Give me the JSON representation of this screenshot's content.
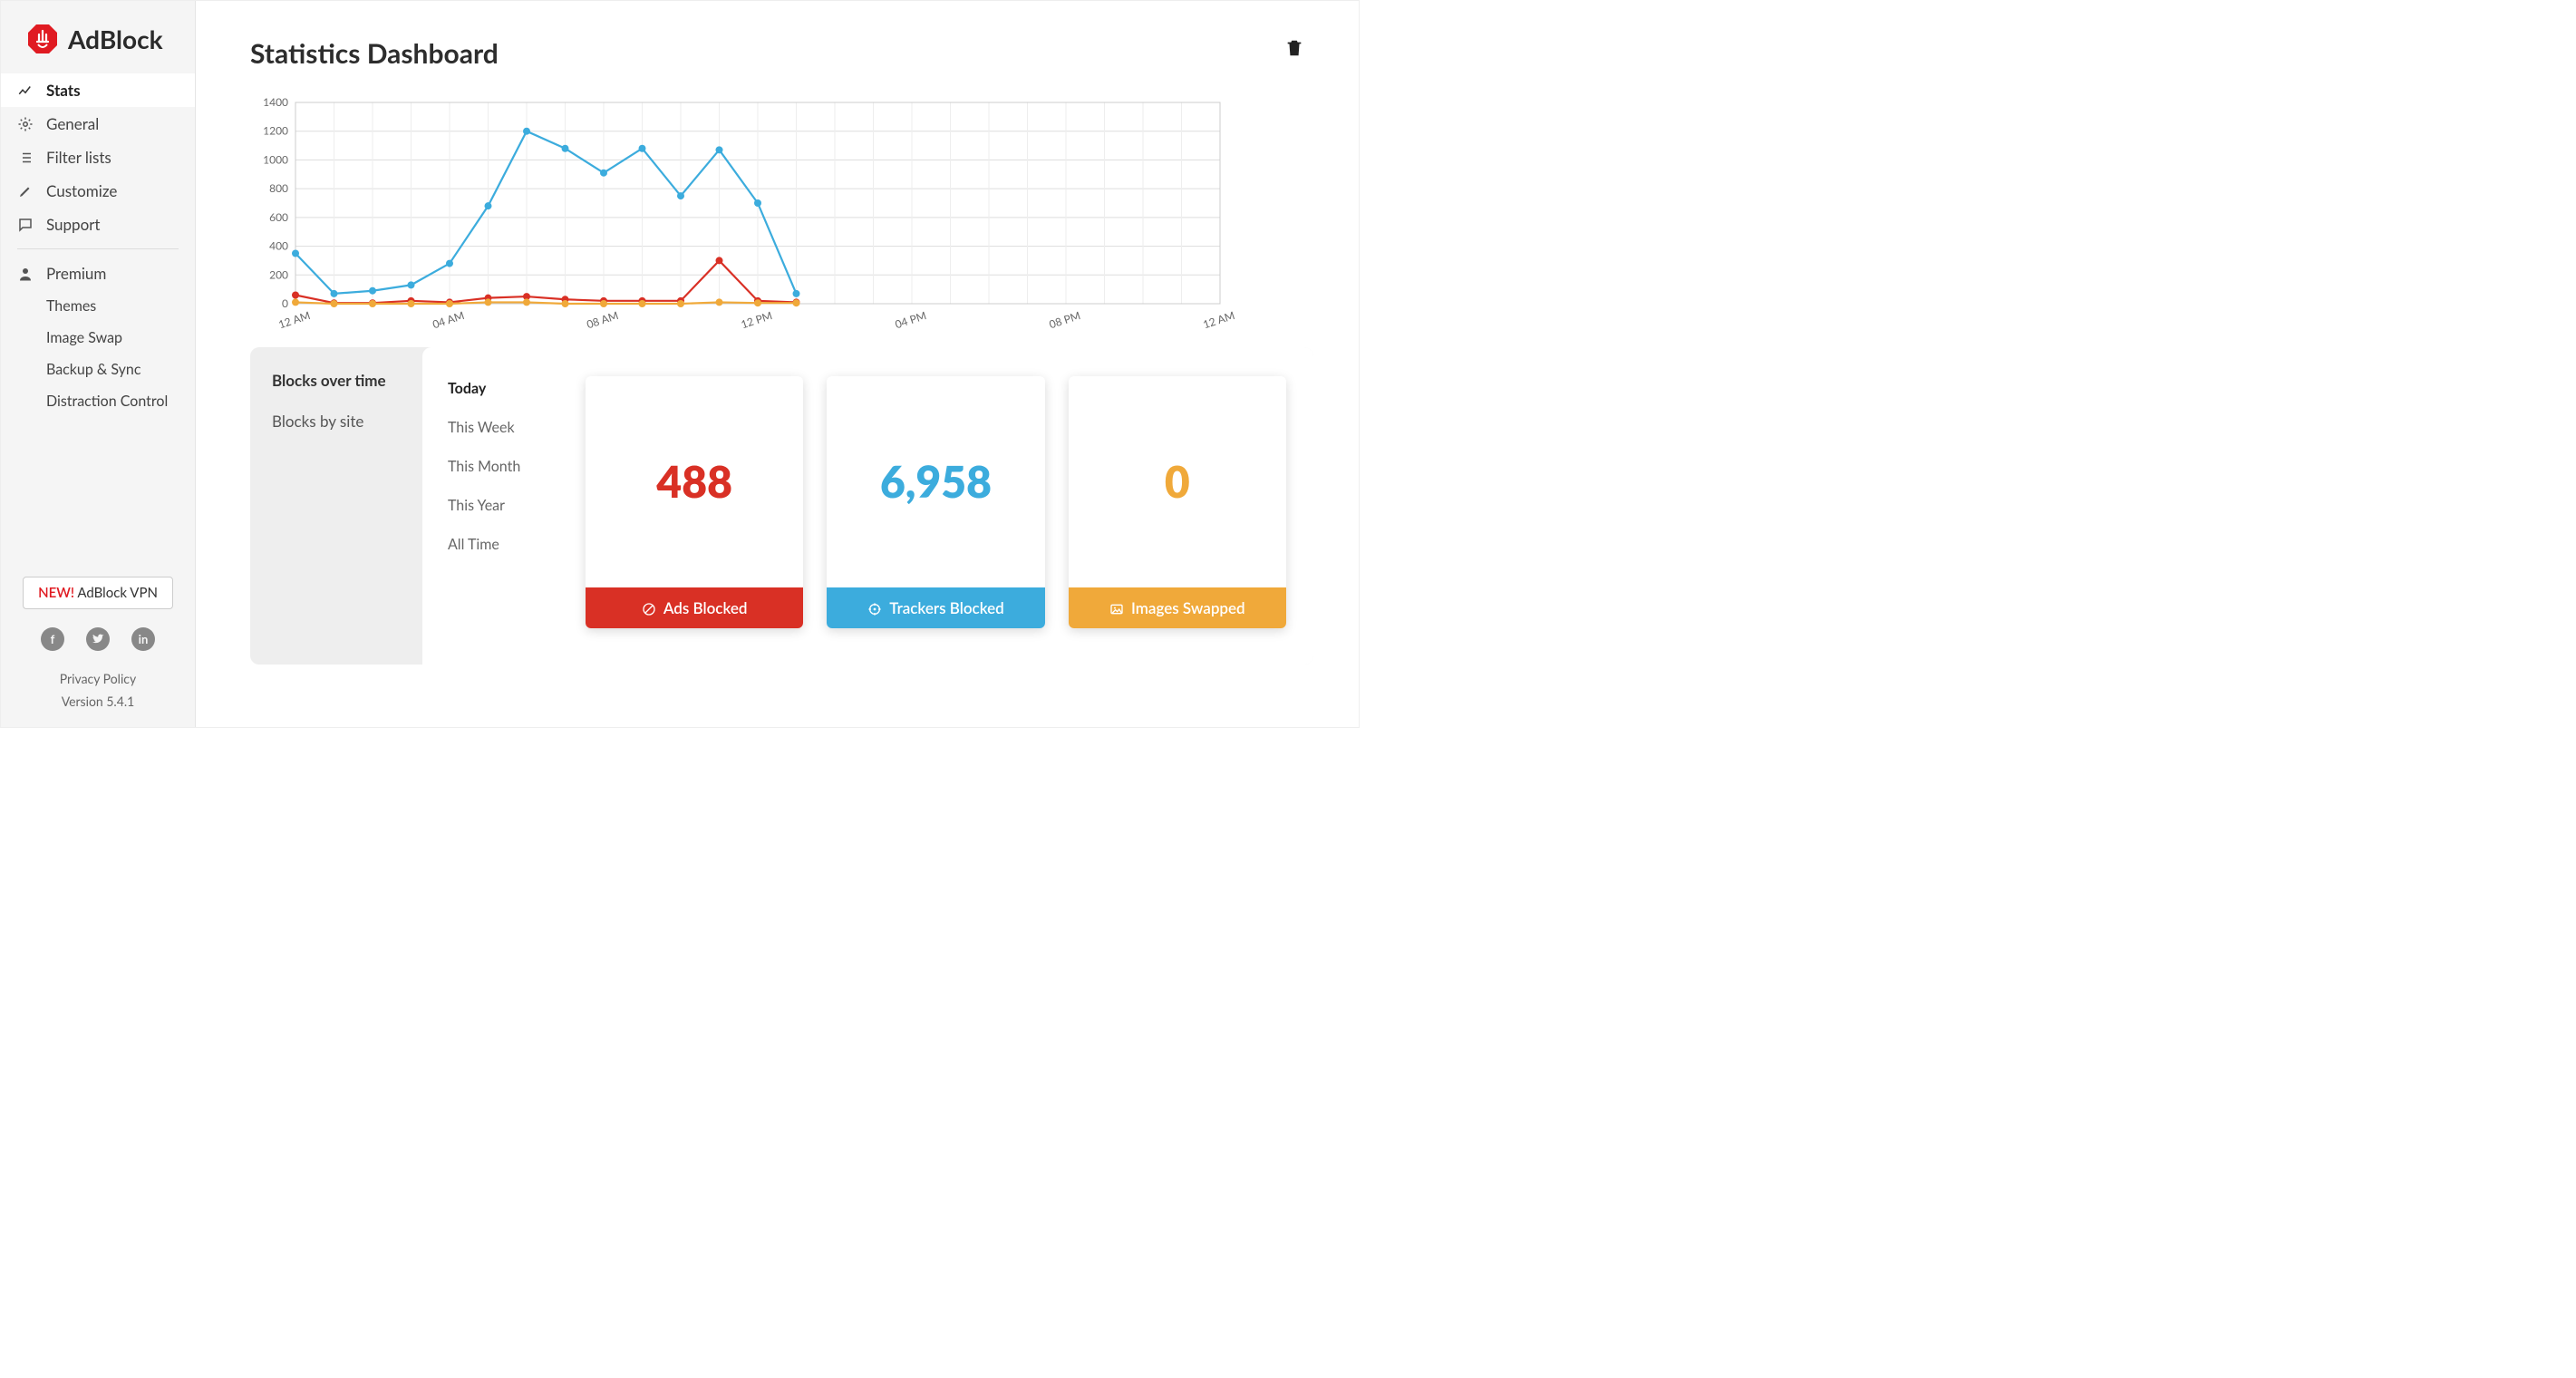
{
  "brand": {
    "name": "AdBlock"
  },
  "sidebar": {
    "nav": [
      {
        "label": "Stats",
        "icon": "timeline"
      },
      {
        "label": "General",
        "icon": "gear"
      },
      {
        "label": "Filter lists",
        "icon": "list"
      },
      {
        "label": "Customize",
        "icon": "pencil"
      },
      {
        "label": "Support",
        "icon": "chat"
      }
    ],
    "premium_label": "Premium",
    "premium_sub": [
      {
        "label": "Themes"
      },
      {
        "label": "Image Swap"
      },
      {
        "label": "Backup & Sync"
      },
      {
        "label": "Distraction Control"
      }
    ],
    "vpn_button": {
      "new": "NEW!",
      "text": "AdBlock VPN"
    },
    "footer": {
      "privacy": "Privacy Policy",
      "version": "Version 5.4.1"
    }
  },
  "page": {
    "title": "Statistics Dashboard"
  },
  "stats_panel": {
    "view_tabs": [
      {
        "label": "Blocks over time",
        "active": true
      },
      {
        "label": "Blocks by site",
        "active": false
      }
    ],
    "period_tabs": [
      {
        "label": "Today",
        "active": true
      },
      {
        "label": "This Week",
        "active": false
      },
      {
        "label": "This Month",
        "active": false
      },
      {
        "label": "This Year",
        "active": false
      },
      {
        "label": "All Time",
        "active": false
      }
    ],
    "cards": {
      "ads": {
        "value": "488",
        "label": "Ads Blocked",
        "color": "#d93025"
      },
      "trackers": {
        "value": "6,958",
        "label": "Trackers Blocked",
        "color": "#3cacdd"
      },
      "images": {
        "value": "0",
        "label": "Images Swapped",
        "color": "#f0a93a"
      }
    }
  },
  "chart_data": {
    "type": "line",
    "title": "",
    "xlabel": "",
    "ylabel": "",
    "ylim": [
      0,
      1400
    ],
    "y_ticks": [
      0,
      200,
      400,
      600,
      800,
      1000,
      1200,
      1400
    ],
    "x_tick_labels": [
      "12 AM",
      "04 AM",
      "08 AM",
      "12 PM",
      "04 PM",
      "08 PM",
      "12 AM"
    ],
    "x": [
      0,
      1,
      2,
      3,
      4,
      5,
      6,
      7,
      8,
      9,
      10,
      11,
      12,
      13
    ],
    "series": [
      {
        "name": "Trackers Blocked",
        "color": "#3cacdd",
        "values": [
          350,
          70,
          90,
          130,
          280,
          680,
          1200,
          1080,
          910,
          1080,
          750,
          1070,
          700,
          70
        ]
      },
      {
        "name": "Ads Blocked",
        "color": "#d93025",
        "values": [
          60,
          5,
          5,
          20,
          10,
          40,
          50,
          30,
          20,
          20,
          20,
          300,
          20,
          10
        ]
      },
      {
        "name": "Images Swapped",
        "color": "#f0a93a",
        "values": [
          10,
          0,
          0,
          0,
          0,
          10,
          10,
          0,
          0,
          0,
          0,
          10,
          5,
          5
        ]
      }
    ]
  }
}
